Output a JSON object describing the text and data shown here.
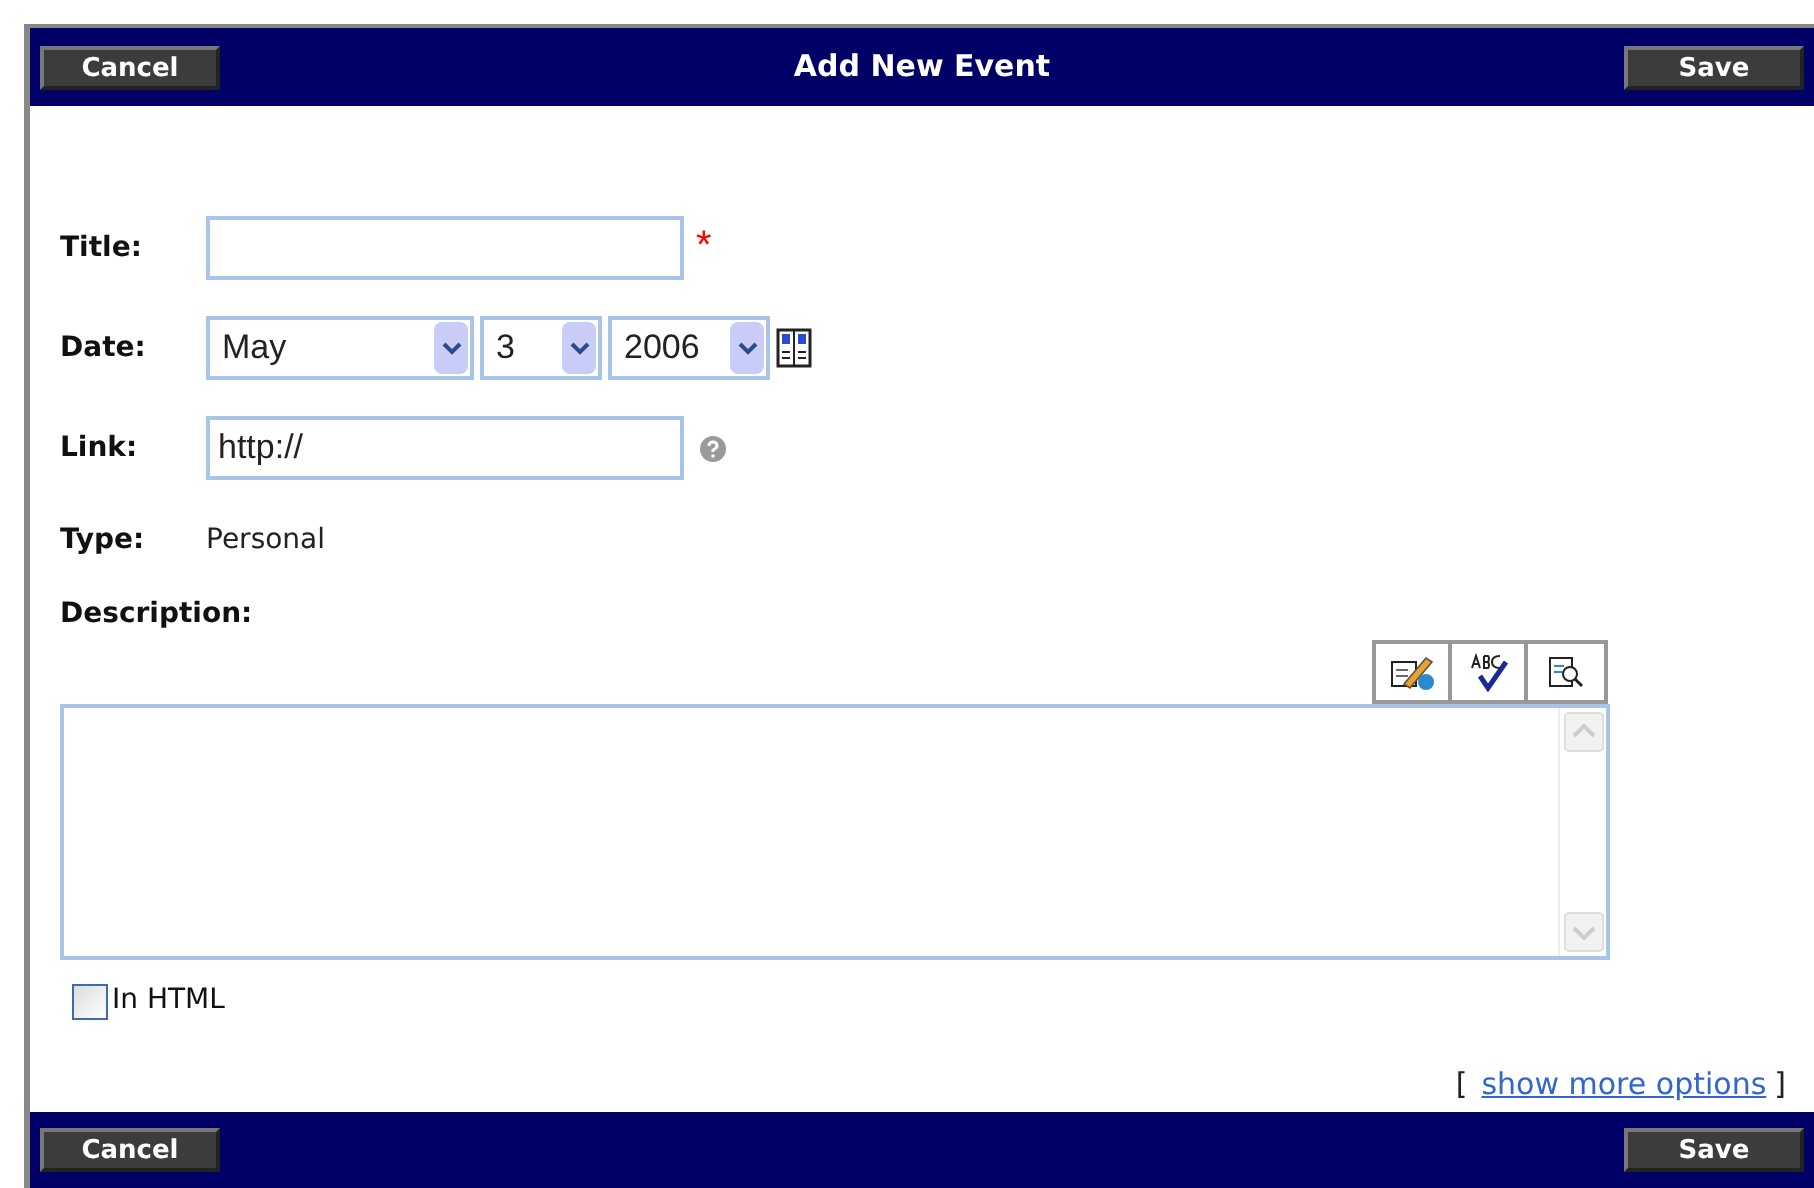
{
  "header": {
    "title": "Add New Event",
    "cancel": "Cancel",
    "save": "Save"
  },
  "form": {
    "title": {
      "label": "Title:",
      "required_mark": "*"
    },
    "date": {
      "label": "Date:",
      "month": "May",
      "day": "3",
      "year": "2006"
    },
    "link": {
      "label": "Link:",
      "value": "http://"
    },
    "type": {
      "label": "Type:",
      "value": "Personal"
    },
    "description": {
      "label": "Description:"
    },
    "in_html": {
      "label": "In HTML",
      "checked": false
    },
    "more_options": {
      "open_bracket": "[",
      "link": "show more options",
      "close_bracket": "]"
    }
  },
  "footer": {
    "cancel": "Cancel",
    "save": "Save"
  }
}
